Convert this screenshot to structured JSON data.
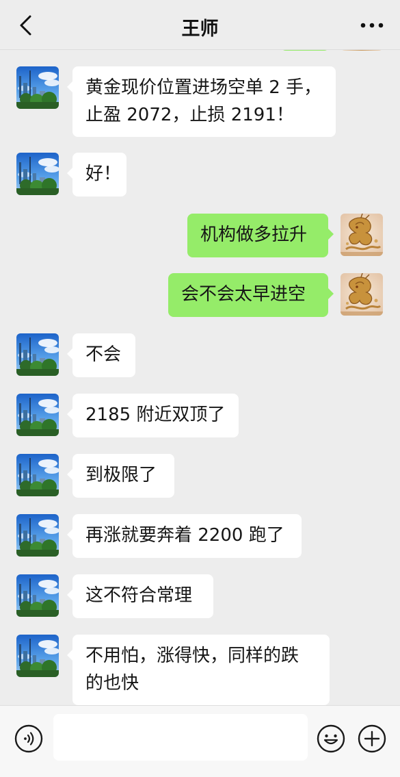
{
  "header": {
    "title": "王师",
    "back_icon": "chevron-left-icon",
    "more_icon": "more-horizontal-icon"
  },
  "messages": [
    {
      "side": "in",
      "lines": [
        "黄金现价位置进场空单 2 手，",
        "止盈 2072，止损 2191！"
      ]
    },
    {
      "side": "in",
      "lines": [
        "好！"
      ]
    },
    {
      "side": "out",
      "lines": [
        "机构做多拉升"
      ]
    },
    {
      "side": "out",
      "lines": [
        "会不会太早进空"
      ]
    },
    {
      "side": "in",
      "lines": [
        "不会"
      ]
    },
    {
      "side": "in",
      "lines": [
        "2185 附近双顶了"
      ]
    },
    {
      "side": "in",
      "lines": [
        "到极限了"
      ]
    },
    {
      "side": "in",
      "lines": [
        "再涨就要奔着 2200 跑了"
      ]
    },
    {
      "side": "in",
      "lines": [
        "这不符合常理"
      ]
    },
    {
      "side": "in",
      "lines": [
        "不用怕，涨得快，同样的跌",
        "的也快"
      ]
    }
  ],
  "input_bar": {
    "voice_icon": "voice-icon",
    "input_value": "",
    "emoji_icon": "emoji-icon",
    "plus_icon": "plus-icon"
  },
  "colors": {
    "background": "#ededed",
    "incoming_bubble": "#ffffff",
    "outgoing_bubble": "#95ec69"
  }
}
